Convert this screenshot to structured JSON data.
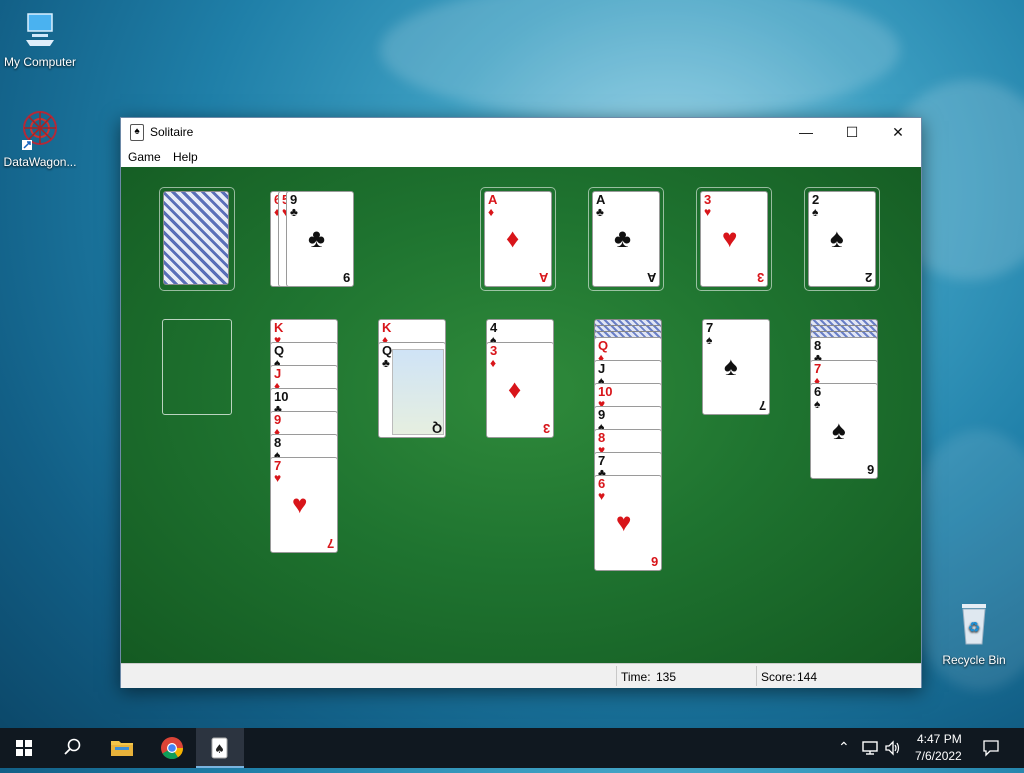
{
  "desktop": {
    "icons": [
      {
        "label": "My Computer"
      },
      {
        "label": "DataWagon..."
      },
      {
        "label": "Recycle Bin"
      }
    ]
  },
  "window": {
    "title": "Solitaire",
    "controls": {
      "minimize": "—",
      "maximize": "☐",
      "close": "✕"
    },
    "menu": [
      "Game",
      "Help"
    ],
    "status": {
      "time_label": "Time:",
      "time_value": "135",
      "score_label": "Score:",
      "score_value": "144"
    }
  },
  "game": {
    "stock": {
      "face_down": true
    },
    "waste": [
      {
        "rank": "6",
        "suit": "♦",
        "color": "red"
      },
      {
        "rank": "5",
        "suit": "♥",
        "color": "red"
      },
      {
        "rank": "9",
        "suit": "♣",
        "color": "black"
      }
    ],
    "foundations": [
      {
        "rank": "A",
        "suit": "♦",
        "color": "red"
      },
      {
        "rank": "A",
        "suit": "♣",
        "color": "black"
      },
      {
        "rank": "3",
        "suit": "♥",
        "color": "red"
      },
      {
        "rank": "2",
        "suit": "♠",
        "color": "black"
      }
    ],
    "tableau": [
      {
        "face_down": 0,
        "cards": []
      },
      {
        "face_down": 0,
        "cards": [
          {
            "rank": "K",
            "suit": "♥",
            "color": "red"
          },
          {
            "rank": "Q",
            "suit": "♠",
            "color": "black"
          },
          {
            "rank": "J",
            "suit": "♦",
            "color": "red"
          },
          {
            "rank": "10",
            "suit": "♣",
            "color": "black"
          },
          {
            "rank": "9",
            "suit": "♦",
            "color": "red"
          },
          {
            "rank": "8",
            "suit": "♠",
            "color": "black"
          },
          {
            "rank": "7",
            "suit": "♥",
            "color": "red"
          }
        ]
      },
      {
        "face_down": 0,
        "cards": [
          {
            "rank": "K",
            "suit": "♦",
            "color": "red"
          },
          {
            "rank": "Q",
            "suit": "♣",
            "color": "black"
          }
        ]
      },
      {
        "face_down": 0,
        "cards": [
          {
            "rank": "4",
            "suit": "♠",
            "color": "black"
          },
          {
            "rank": "3",
            "suit": "♦",
            "color": "red"
          }
        ]
      },
      {
        "face_down": 3,
        "cards": [
          {
            "rank": "Q",
            "suit": "♦",
            "color": "red"
          },
          {
            "rank": "J",
            "suit": "♠",
            "color": "black"
          },
          {
            "rank": "10",
            "suit": "♥",
            "color": "red"
          },
          {
            "rank": "9",
            "suit": "♠",
            "color": "black"
          },
          {
            "rank": "8",
            "suit": "♥",
            "color": "red"
          },
          {
            "rank": "7",
            "suit": "♣",
            "color": "black"
          },
          {
            "rank": "6",
            "suit": "♥",
            "color": "red"
          }
        ]
      },
      {
        "face_down": 0,
        "cards": [
          {
            "rank": "7",
            "suit": "♠",
            "color": "black"
          }
        ]
      },
      {
        "face_down": 3,
        "cards": [
          {
            "rank": "8",
            "suit": "♣",
            "color": "black"
          },
          {
            "rank": "7",
            "suit": "♦",
            "color": "red"
          },
          {
            "rank": "6",
            "suit": "♠",
            "color": "black"
          }
        ]
      }
    ]
  },
  "taskbar": {
    "items": [
      "start-icon",
      "search-icon",
      "file-explorer-icon",
      "chrome-icon",
      "solitaire-icon"
    ],
    "clock_time": "4:47 PM",
    "clock_date": "7/6/2022"
  }
}
